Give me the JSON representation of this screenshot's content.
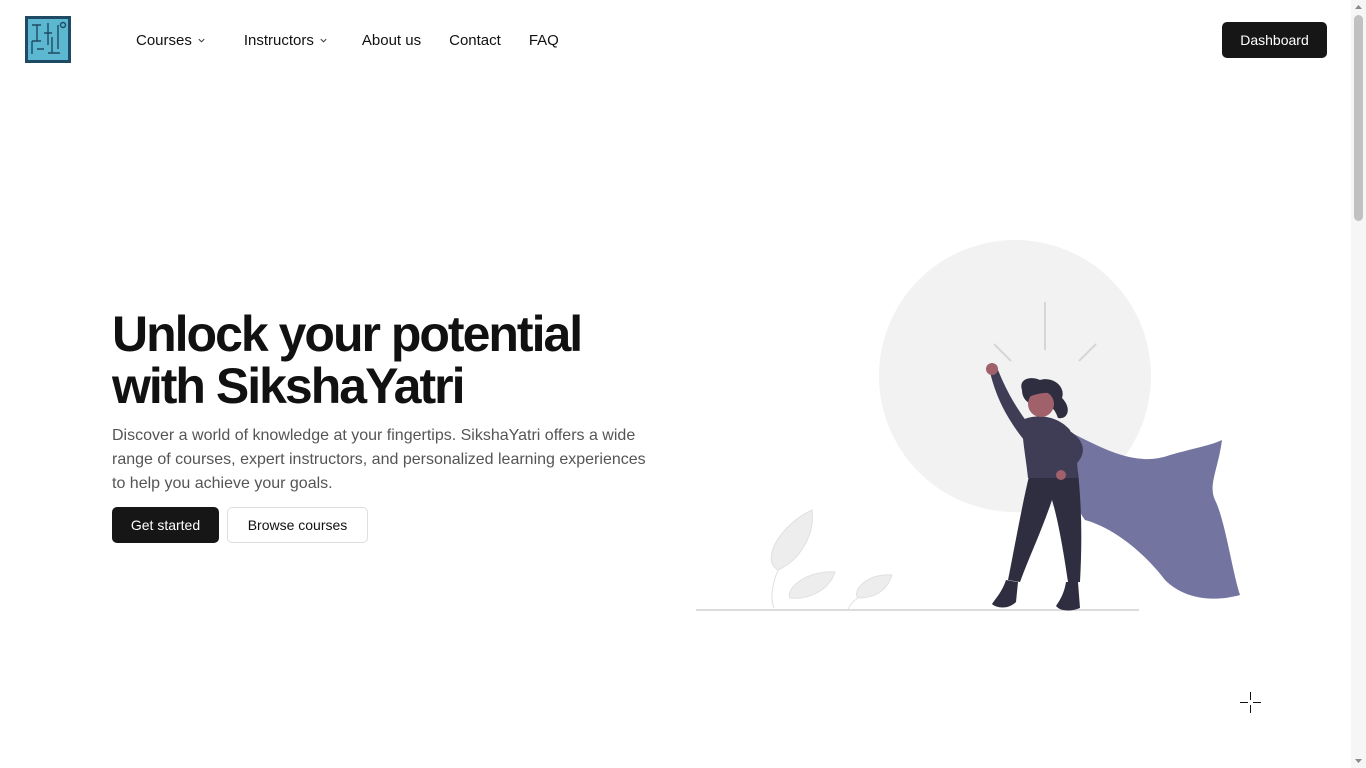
{
  "header": {
    "logo_icon": "siksha-yatri-logo-icon",
    "nav": [
      {
        "label": "Courses",
        "has_dropdown": true
      },
      {
        "label": "Instructors",
        "has_dropdown": true
      },
      {
        "label": "About us",
        "has_dropdown": false
      },
      {
        "label": "Contact",
        "has_dropdown": false
      },
      {
        "label": "FAQ",
        "has_dropdown": false
      }
    ],
    "dashboard_label": "Dashboard"
  },
  "hero": {
    "title_line1": "Unlock your potential",
    "title_line2": "with SikshaYatri",
    "subtitle": "Discover a world of knowledge at your fingertips. SikshaYatri offers a wide range of courses, expert instructors, and personalized learning experiences to help you achieve your goals.",
    "primary_button": "Get started",
    "secondary_button": "Browse courses",
    "illustration_icon": "superhero-woman-illustration-icon"
  },
  "colors": {
    "primary_button": "#161616",
    "logo_bg": "#1e4a63",
    "logo_fill": "#5bb8d0",
    "cape": "#7474a0",
    "figure_dark": "#2f2e41",
    "skin": "#a0616a",
    "circle": "#f2f2f2"
  }
}
